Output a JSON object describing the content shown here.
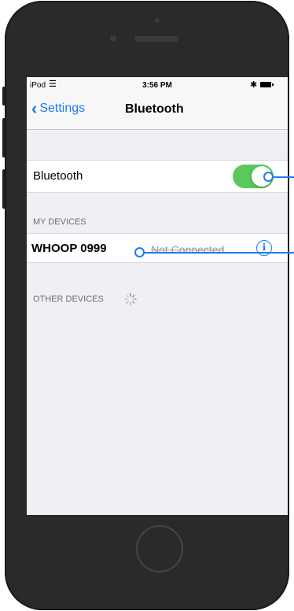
{
  "status_bar": {
    "carrier": "iPod",
    "time": "3:56 PM"
  },
  "nav": {
    "back_label": "Settings",
    "title": "Bluetooth"
  },
  "bluetooth_row": {
    "label": "Bluetooth",
    "enabled": true,
    "accent_color": "#5ac85a"
  },
  "my_devices": {
    "header": "MY DEVICES",
    "devices": [
      {
        "name": "WHOOP 0999",
        "status": "Not Connected"
      }
    ]
  },
  "other_devices": {
    "header": "OTHER DEVICES"
  },
  "colors": {
    "ios_blue": "#1e7cf2",
    "phone_body": "#2a2a2a"
  },
  "icons": [
    "chevron-left-icon",
    "wifi-icon",
    "bluetooth-icon",
    "battery-icon",
    "info-icon",
    "spinner-icon"
  ]
}
